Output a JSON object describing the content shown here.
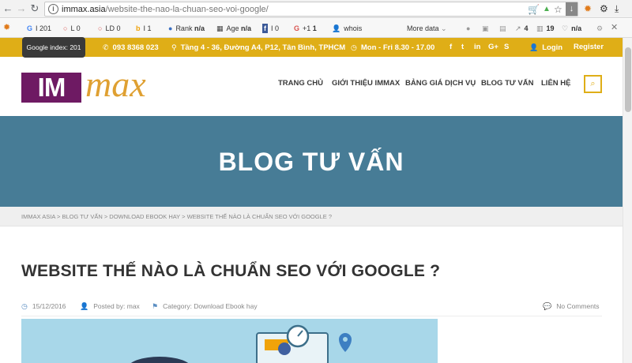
{
  "browser": {
    "url_domain": "immax.asia",
    "url_path": "/website-the-nao-la-chuan-seo-voi-google/"
  },
  "seo_toolbar": {
    "google_index": "I 201",
    "links": "L 0",
    "linking_domains": "LD 0",
    "indexed": "I 1",
    "rank_label": "Rank",
    "rank_value": "n/a",
    "age_label": "Age",
    "age_value": "n/a",
    "facebook": "0",
    "gplus_label": "+1",
    "gplus_value": "1",
    "whois": "whois",
    "more_data": "More data",
    "stat_a": "4",
    "stat_b": "19",
    "stat_c": "n/a"
  },
  "tooltip": "Google index: 201",
  "topbar": {
    "phone": "093 8368 023",
    "address": "Tầng 4 - 36, Đường A4, P12, Tân Bình, TPHCM",
    "hours": "Mon - Fri 8.30 - 17.00",
    "social": [
      "f",
      "t",
      "in",
      "G+",
      "S"
    ],
    "login": "Login",
    "register": "Register"
  },
  "logo": {
    "box": "IM",
    "text": "max"
  },
  "menu": [
    "TRANG CHỦ",
    "GIỚI THIỆU IMMAX",
    "BẢNG GIÁ DỊCH VỤ",
    "BLOG TƯ VẤN",
    "LIÊN HỆ"
  ],
  "banner": {
    "title": "BLOG TƯ VẤN"
  },
  "breadcrumb": "IMMAX ASIA > BLOG TƯ VẤN > DOWNLOAD EBOOK HAY > WEBSITE THẾ NÀO LÀ CHUẨN SEO VỚI GOOGLE ?",
  "post": {
    "title": "WEBSITE THẾ NÀO LÀ CHUẨN SEO VỚI GOOGLE ?",
    "date": "15/12/2016",
    "author": "Posted by: max",
    "category": "Category: Download Ebook hay",
    "comments": "No Comments"
  },
  "colors": {
    "brand_yellow": "#dfae17",
    "brand_purple": "#6e1a63",
    "banner_blue": "#477c96",
    "logo_orange": "#dfa032"
  }
}
